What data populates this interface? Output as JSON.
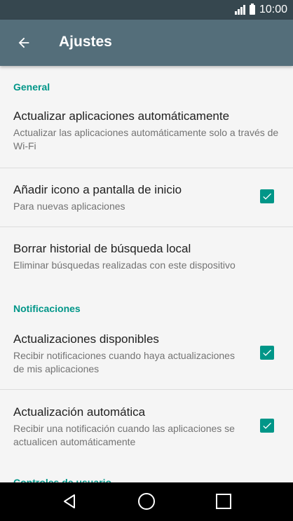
{
  "status_bar": {
    "time": "10:00",
    "icons": [
      "signal-icon",
      "battery-icon"
    ]
  },
  "app_bar": {
    "back_icon": "arrow-left-icon",
    "title": "Ajustes"
  },
  "sections": {
    "general": {
      "header": "General",
      "items": [
        {
          "title": "Actualizar aplicaciones automáticamente",
          "subtitle": "Actualizar las aplicaciones automáticamente solo a través de Wi-Fi"
        },
        {
          "title": "Añadir icono a pantalla de inicio",
          "subtitle": "Para nuevas aplicaciones",
          "checked": true
        },
        {
          "title": "Borrar historial de búsqueda local",
          "subtitle": "Eliminar búsquedas realizadas con este dispositivo"
        }
      ]
    },
    "notifications": {
      "header": "Notificaciones",
      "items": [
        {
          "title": "Actualizaciones disponibles",
          "subtitle": "Recibir notificaciones cuando haya actualizaciones de mis aplicaciones",
          "checked": true
        },
        {
          "title": "Actualización automática",
          "subtitle": "Recibir una notificación cuando las aplicaciones se actualicen automáticamente",
          "checked": true
        }
      ]
    },
    "user_controls": {
      "header": "Controles de usuario"
    }
  },
  "nav_bar": {
    "icons": [
      "back-triangle-icon",
      "home-circle-icon",
      "recents-square-icon"
    ]
  },
  "colors": {
    "status_bar": "#36474f",
    "app_bar": "#546e7a",
    "accent": "#009688",
    "background": "#f5f5f5"
  }
}
